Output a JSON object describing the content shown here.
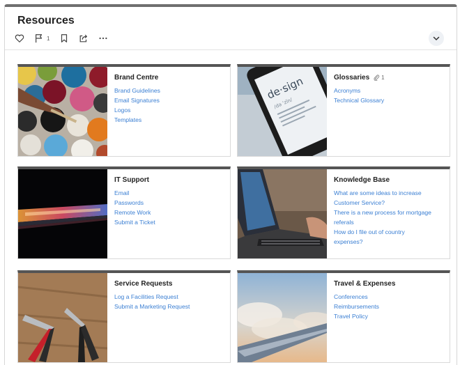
{
  "page": {
    "title": "Resources",
    "actions": {
      "like_icon": "heart-icon",
      "flag_count": "1",
      "bookmark_icon": "bookmark-icon",
      "share_icon": "share-icon",
      "more_icon": "more-icon"
    },
    "collapse_icon": "chevron-down-icon"
  },
  "cards": [
    {
      "title": "Brand Centre",
      "image": "paint-pots",
      "links": [
        "Brand Guidelines",
        "Email Signatures",
        "Logos",
        "Templates"
      ]
    },
    {
      "title": "Glossaries",
      "attachment_count": "1",
      "image": "phone-design",
      "links": [
        "Acronyms",
        "Technical Glossary"
      ]
    },
    {
      "title": "IT Support",
      "image": "laptop-dark",
      "links": [
        "Email",
        "Passwords",
        "Remote Work",
        "Submit a Ticket"
      ]
    },
    {
      "title": "Knowledge Base",
      "image": "laptop-typing",
      "links": [
        "What are some ideas to increase",
        "Customer Service?",
        "There is a new process for mortgage",
        "referals",
        "How do I file out of country",
        "expenses?"
      ]
    },
    {
      "title": "Service Requests",
      "image": "pliers",
      "links": [
        "Log a Facilities Request",
        "Submit a Marketing Request"
      ]
    },
    {
      "title": "Travel & Expenses",
      "image": "airplane-wing",
      "links": [
        "Conferences",
        "Reimbursements",
        "Travel Policy"
      ]
    }
  ]
}
